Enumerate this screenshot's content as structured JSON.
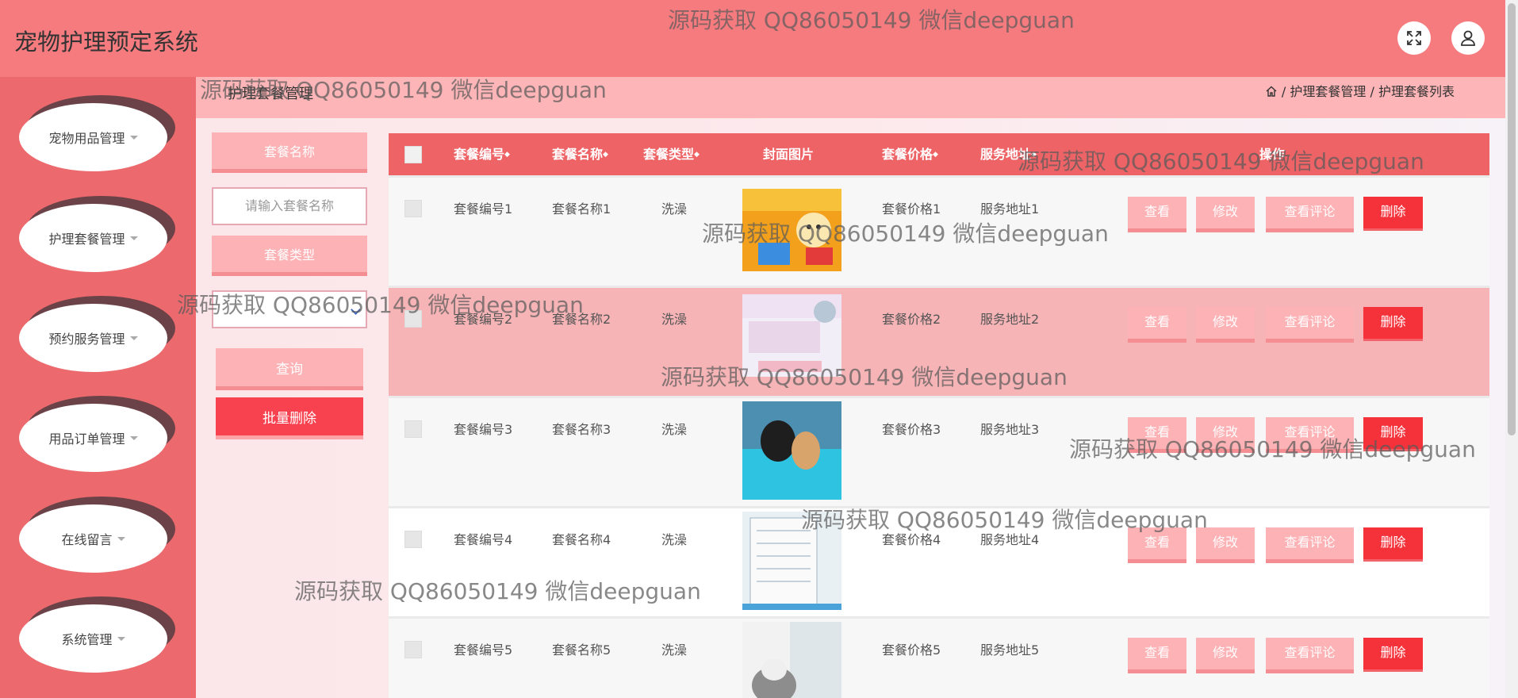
{
  "app": {
    "title": "宠物护理预定系统"
  },
  "watermark": "源码获取 QQ86050149 微信deepguan",
  "sidebar": {
    "items": [
      {
        "label": "宠物用品管理"
      },
      {
        "label": "护理套餐管理"
      },
      {
        "label": "预约服务管理"
      },
      {
        "label": "用品订单管理"
      },
      {
        "label": "在线留言"
      },
      {
        "label": "系统管理"
      }
    ]
  },
  "breadcrumb": {
    "section": "护理套餐管理",
    "items": [
      "护理套餐管理",
      "护理套餐列表"
    ],
    "separator": "/"
  },
  "search": {
    "name_label": "套餐名称",
    "name_placeholder": "请输入套餐名称",
    "type_label": "套餐类型",
    "query_button": "查询",
    "batch_delete_button": "批量删除"
  },
  "table": {
    "headers": {
      "id": "套餐编号",
      "name": "套餐名称",
      "type": "套餐类型",
      "cover": "封面图片",
      "price": "套餐价格",
      "address": "服务地址",
      "actions": "操作"
    },
    "rows": [
      {
        "id": "套餐编号1",
        "name": "套餐名称1",
        "type": "洗澡",
        "price": "套餐价格1",
        "address": "服务地址1"
      },
      {
        "id": "套餐编号2",
        "name": "套餐名称2",
        "type": "洗澡",
        "price": "套餐价格2",
        "address": "服务地址2"
      },
      {
        "id": "套餐编号3",
        "name": "套餐名称3",
        "type": "洗澡",
        "price": "套餐价格3",
        "address": "服务地址3"
      },
      {
        "id": "套餐编号4",
        "name": "套餐名称4",
        "type": "洗澡",
        "price": "套餐价格4",
        "address": "服务地址4"
      },
      {
        "id": "套餐编号5",
        "name": "套餐名称5",
        "type": "洗澡",
        "price": "套餐价格5",
        "address": "服务地址5"
      }
    ],
    "action_labels": {
      "view": "查看",
      "edit": "修改",
      "reviews": "查看评论",
      "delete": "删除"
    }
  },
  "colors": {
    "header": "#f67b7f",
    "sidebar": "#ec6a6e",
    "table_header": "#ee6366",
    "delete": "#f5313a",
    "highlight_row": "#f6b4b6"
  }
}
